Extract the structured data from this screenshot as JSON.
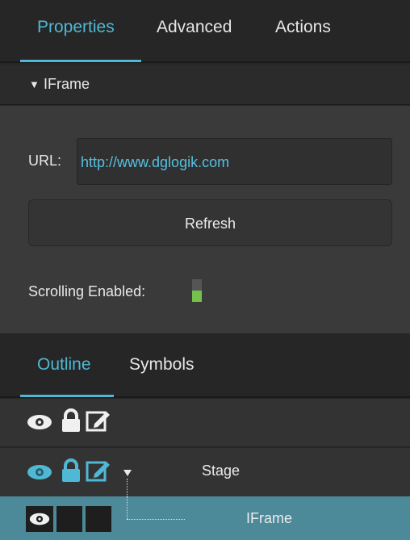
{
  "top_tabs": [
    {
      "label": "Properties",
      "active": true
    },
    {
      "label": "Advanced",
      "active": false
    },
    {
      "label": "Actions",
      "active": false
    }
  ],
  "section": {
    "title": "IFrame",
    "expanded": true
  },
  "url_field": {
    "label": "URL:",
    "value": "http://www.dglogik.com"
  },
  "refresh_button": {
    "label": "Refresh"
  },
  "scrolling": {
    "label": "Scrolling Enabled:",
    "enabled": true
  },
  "bottom_tabs": [
    {
      "label": "Outline",
      "active": true
    },
    {
      "label": "Symbols",
      "active": false
    }
  ],
  "outline_rows": [
    {
      "label": "",
      "icons": [
        "eye-icon",
        "lock-icon",
        "edit-icon"
      ]
    },
    {
      "label": "Stage",
      "icons": [
        "eye-icon",
        "lock-icon",
        "edit-icon"
      ],
      "expanded": true
    },
    {
      "label": "IFrame",
      "icons": [
        "eye-icon"
      ],
      "selected": true
    }
  ],
  "colors": {
    "accent": "#4fb8d4",
    "selected_row": "#4c8a99",
    "toggle_on": "#74c04a",
    "link": "#57bfe0"
  }
}
